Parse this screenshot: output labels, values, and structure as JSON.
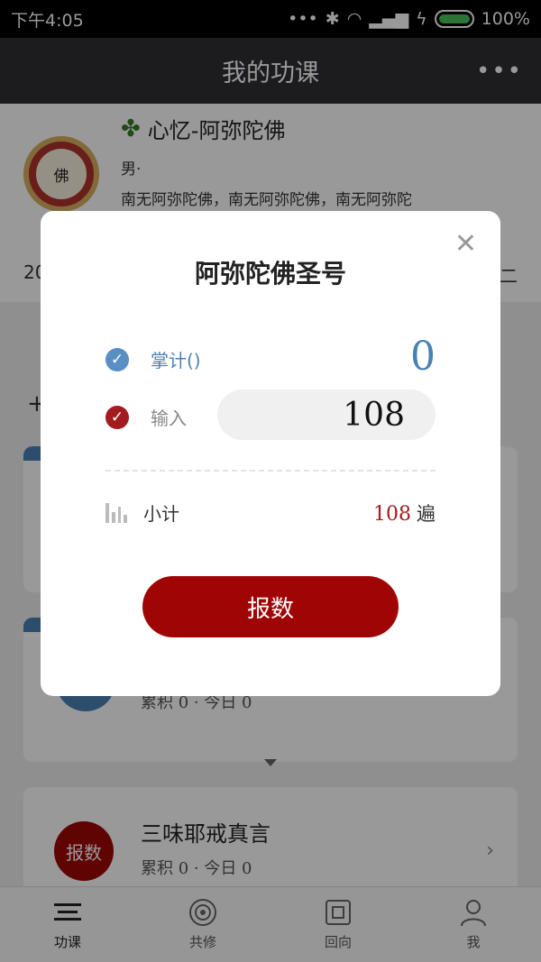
{
  "status_bar": {
    "time": "下午4:05",
    "battery": "100%"
  },
  "header": {
    "title": "我的功课",
    "more": "•••"
  },
  "profile": {
    "name": "心忆-阿弥陀佛",
    "gender": "男·",
    "desc": "南无阿弥陀佛，南无阿弥陀佛，南无阿弥陀",
    "row_left": "20",
    "row_right": "二",
    "avatar_text": "佛"
  },
  "bg": {
    "plus": "+"
  },
  "cards": [
    {
      "stat": "累积 0 · 今日 0"
    },
    {
      "badge": "报数",
      "title": "三味耶戒真言",
      "stat": "累积 0 · 今日 0"
    }
  ],
  "dialog": {
    "title": "阿弥陀佛圣号",
    "tally_label": "掌计()",
    "tally_value": "0",
    "input_label": "输入",
    "input_value": "108",
    "subtotal_label": "小计",
    "subtotal_value": "108",
    "subtotal_unit": "遍",
    "submit_label": "报数"
  },
  "tabs": [
    {
      "label": "功课"
    },
    {
      "label": "共修"
    },
    {
      "label": "回向"
    },
    {
      "label": "我"
    }
  ],
  "colors": {
    "accent_red": "#a00505",
    "accent_blue": "#4a82b4",
    "header_bg": "#303035"
  }
}
